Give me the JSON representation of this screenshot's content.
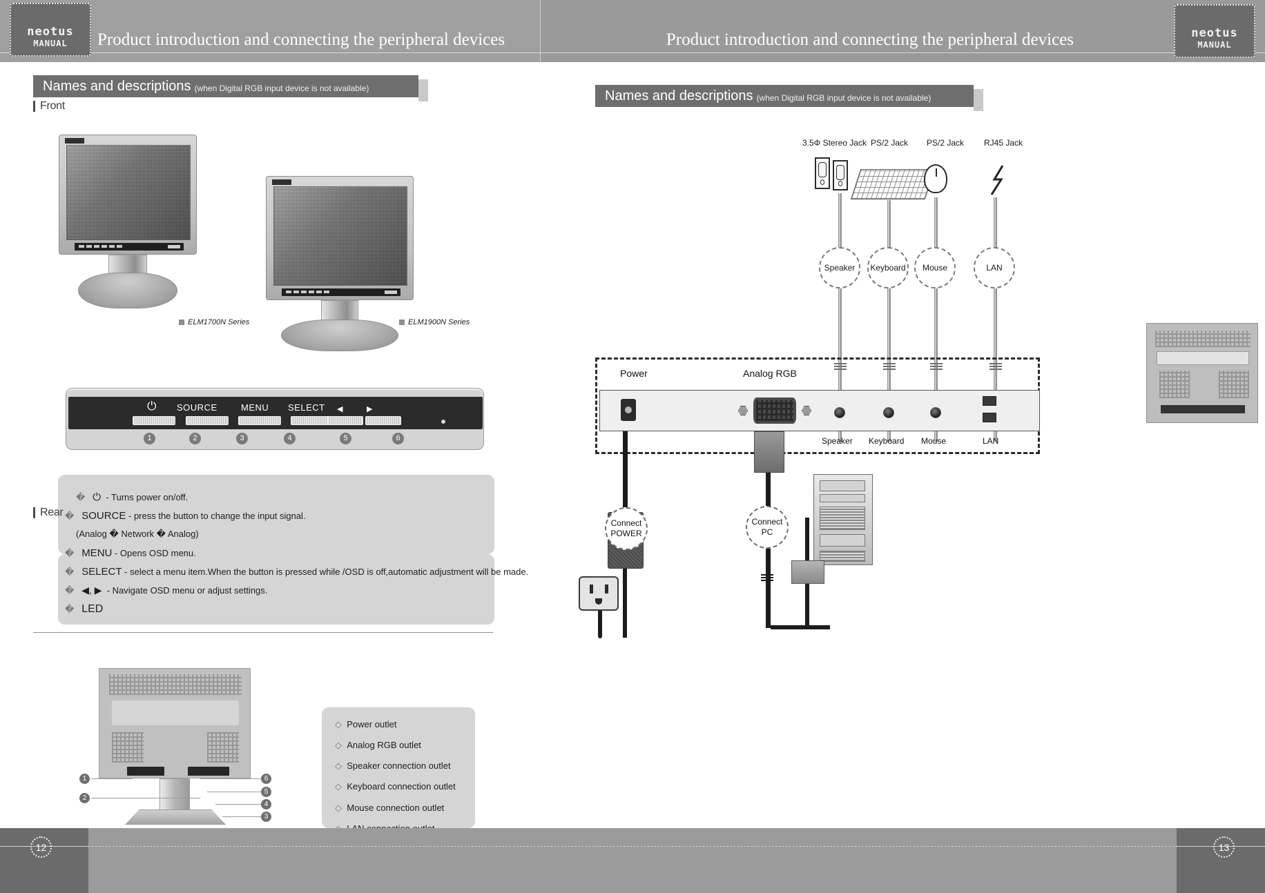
{
  "header": {
    "logo_primary": "neotus",
    "logo_secondary": "MANUAL",
    "title_left": "Product introduction and connecting the peripheral devices",
    "title_right": "Product introduction and connecting the peripheral devices"
  },
  "footer": {
    "page_left": "12",
    "page_right": "13"
  },
  "left_page": {
    "section": {
      "title": "Names and descriptions",
      "subtitle": "(when Digital RGB input device is not available)"
    },
    "front_heading": "Front",
    "rear_heading": "Rear",
    "models": [
      {
        "label": "ELM1700N Series"
      },
      {
        "label": "ELM1900N Series"
      }
    ],
    "control_panel": {
      "labels": [
        "SOURCE",
        "MENU",
        "SELECT"
      ],
      "power_glyph": "⏻",
      "left_arrow": "◀",
      "right_arrow": "▶",
      "numbers": [
        "1",
        "2",
        "3",
        "4",
        "5",
        "6"
      ]
    },
    "descriptions": [
      {
        "bullet": "�",
        "icon": "power-icon",
        "text": "- Turns power on/off."
      },
      {
        "bullet": "�",
        "term": "SOURCE",
        "text": "- press the button to change the input signal."
      },
      {
        "bullet": "",
        "term": "",
        "text": "(Analog � Network � Analog)"
      },
      {
        "bullet": "�",
        "term": "MENU",
        "text": "- Opens OSD menu."
      },
      {
        "bullet": "�",
        "term": "SELECT",
        "text": "- select a menu item.When the button is pressed while /OSD is off,automatic adjustment will be made."
      },
      {
        "bullet": "�",
        "term": "◀, ▶",
        "text": "- Navigate OSD menu or adjust settings."
      },
      {
        "bullet": "�",
        "term": "LED",
        "text": ""
      }
    ],
    "rear_callouts": [
      "1",
      "2",
      "6",
      "5",
      "4",
      "3"
    ],
    "outlets": [
      "Power outlet",
      "Analog RGB outlet",
      "Speaker connection outlet",
      "Keyboard connection outlet",
      "Mouse connection outlet",
      "LAN connection outlet"
    ]
  },
  "right_page": {
    "section": {
      "title": "Names and descriptions",
      "subtitle": "(when Digital RGB input device is not available)"
    },
    "jack_labels": [
      "3.5Φ Stereo Jack",
      "PS/2 Jack",
      "PS/2 Jack",
      "RJ45 Jack"
    ],
    "device_circles": [
      "Speaker",
      "Keyboard",
      "Mouse",
      "LAN"
    ],
    "port_labels_top": [
      "Power",
      "Analog RGB"
    ],
    "port_labels_bottom": [
      "Speaker",
      "Keyboard",
      "Mouse",
      "LAN"
    ],
    "connect_power": {
      "line1": "Connect",
      "line2": "POWER"
    },
    "connect_pc": {
      "line1": "Connect",
      "line2": "PC"
    }
  },
  "colors": {
    "header_band": "#9a9a9a",
    "section_bar": "#6e6e6e",
    "panel_bg": "#d5d5d5",
    "footer_dark": "#6b6b6b",
    "footer_mid": "#9b9b9b"
  }
}
